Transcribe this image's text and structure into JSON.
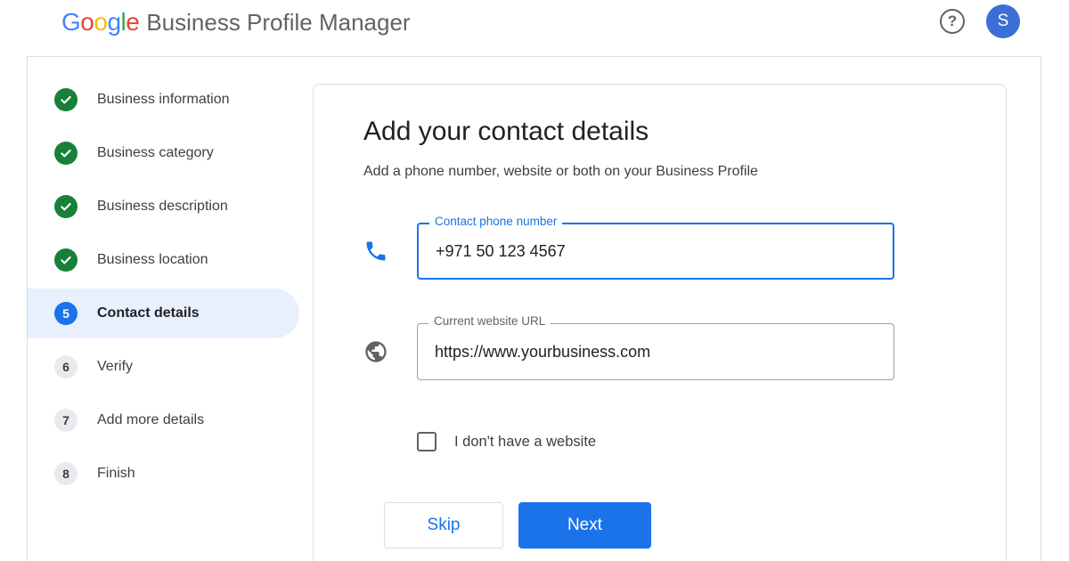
{
  "header": {
    "logo_letters": [
      "G",
      "o",
      "o",
      "g",
      "l",
      "e"
    ],
    "product_name": "Business Profile Manager",
    "help_icon": "help-circle-icon",
    "help_glyph": "?",
    "avatar_initial": "S"
  },
  "sidebar": {
    "steps": [
      {
        "label": "Business information",
        "status": "done",
        "icon": "check-circle-icon"
      },
      {
        "label": "Business category",
        "status": "done",
        "icon": "check-circle-icon"
      },
      {
        "label": "Business description",
        "status": "done",
        "icon": "check-circle-icon"
      },
      {
        "label": "Business location",
        "status": "done",
        "icon": "check-circle-icon"
      },
      {
        "label": "Contact details",
        "status": "current",
        "number": "5"
      },
      {
        "label": "Verify",
        "status": "todo",
        "number": "6"
      },
      {
        "label": "Add more details",
        "status": "todo",
        "number": "7"
      },
      {
        "label": "Finish",
        "status": "todo",
        "number": "8"
      }
    ]
  },
  "card": {
    "title": "Add your contact details",
    "subtitle": "Add a phone number, website or both on your Business Profile",
    "phone": {
      "label": "Contact phone number",
      "value": "+971 50 123 4567",
      "icon": "phone-icon"
    },
    "website": {
      "label": "Current website URL",
      "value": "https://www.yourbusiness.com",
      "icon": "globe-icon"
    },
    "no_website_label": "I don't have a website",
    "no_website_checked": false,
    "skip_label": "Skip",
    "next_label": "Next"
  },
  "colors": {
    "accent": "#1a73e8",
    "done_green": "#188038",
    "active_step_bg": "#e8f0fe",
    "avatar_bg": "#3c6ed6"
  }
}
